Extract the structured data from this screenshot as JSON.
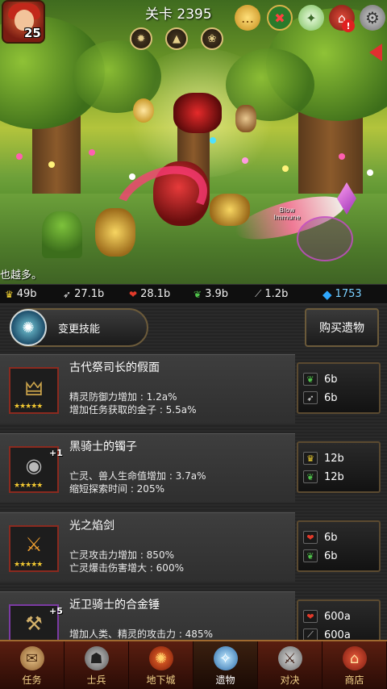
{
  "hud": {
    "stage": "关卡 2395",
    "player_level": "25",
    "icons": [
      "chat-icon",
      "shield-quest-icon",
      "angel-icon",
      "house-alert-icon",
      "settings-icon"
    ],
    "skills": [
      "sword-skill-icon",
      "triangle-skill-icon",
      "wing-skill-icon"
    ],
    "message": "也越多。",
    "overlay_text": "Blow Immune"
  },
  "resources": [
    {
      "icon": "crown-icon",
      "value": "49b",
      "color": "#f2d232"
    },
    {
      "icon": "feather-icon",
      "value": "27.1b",
      "color": "#e8e8e8"
    },
    {
      "icon": "heart-icon",
      "value": "28.1b",
      "color": "#e23a2a"
    },
    {
      "icon": "leaf-icon",
      "value": "3.9b",
      "color": "#4fc24a"
    },
    {
      "icon": "blade-icon",
      "value": "1.2b",
      "color": "#cfcfcf"
    },
    {
      "icon": "diamond-icon",
      "value": "1753",
      "color": "#2fa8ff"
    }
  ],
  "panel": {
    "change_skill_label": "变更技能",
    "buy_relic_label": "购买遗物"
  },
  "relics": [
    {
      "name": "古代祭司长的假面",
      "stats": [
        "精灵防御力增加 : 1.2a%",
        "增加任务获取的金子 : 5.5a%"
      ],
      "stars": "★★★★★",
      "plus": "",
      "icon": "mask-icon",
      "costs": [
        {
          "icon": "leaf-icon",
          "value": "6b"
        },
        {
          "icon": "feather-icon",
          "value": "6b"
        }
      ]
    },
    {
      "name": "黑骑士的镯子",
      "stats": [
        "亡灵、兽人生命值增加 : 3.7a%",
        "缩短探索时间 : 205%"
      ],
      "stars": "★★★★★",
      "plus": "+1",
      "icon": "bracelet-icon",
      "costs": [
        {
          "icon": "crown-icon",
          "value": "12b"
        },
        {
          "icon": "leaf-icon",
          "value": "12b"
        }
      ]
    },
    {
      "name": "光之焰剑",
      "stats": [
        "亡灵攻击力增加 : 850%",
        "亡灵爆击伤害增大 : 600%"
      ],
      "stars": "★★★★★",
      "plus": "",
      "icon": "flame-sword-icon",
      "costs": [
        {
          "icon": "heart-icon",
          "value": "6b"
        },
        {
          "icon": "leaf-icon",
          "value": "6b"
        }
      ]
    },
    {
      "name": "近卫骑士的合金锤",
      "stats": [
        "增加人类、精灵的攻击力 : 485%",
        ""
      ],
      "stars": "★★★★★",
      "plus": "+5",
      "icon": "hammer-icon",
      "costs": [
        {
          "icon": "heart-icon",
          "value": "600a"
        },
        {
          "icon": "blade-icon",
          "value": "600a"
        }
      ]
    }
  ],
  "nav": [
    {
      "label": "任务",
      "icon": "scroll-icon",
      "active": false
    },
    {
      "label": "士兵",
      "icon": "soldier-icon",
      "active": false
    },
    {
      "label": "地下城",
      "icon": "dungeon-icon",
      "active": false
    },
    {
      "label": "遗物",
      "icon": "relic-orb-icon",
      "active": true
    },
    {
      "label": "对决",
      "icon": "crossed-swords-icon",
      "active": false
    },
    {
      "label": "商店",
      "icon": "shop-icon",
      "active": false
    }
  ]
}
